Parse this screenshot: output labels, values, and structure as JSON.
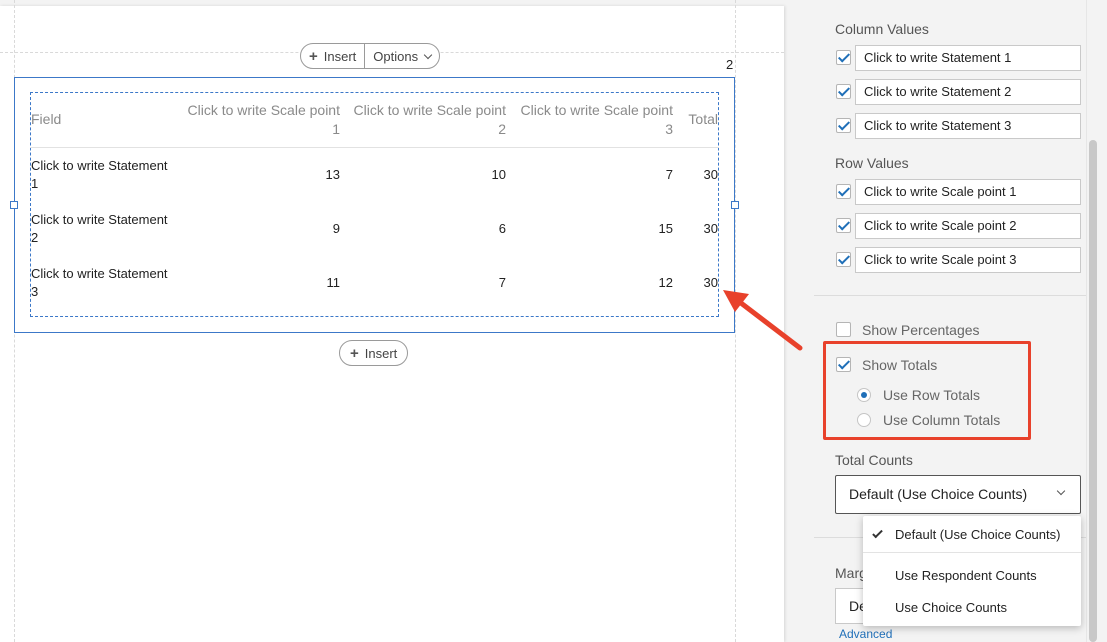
{
  "canvas": {
    "insert_label": "Insert",
    "options_label": "Options",
    "page_number": "2",
    "table": {
      "headers": [
        "Field",
        "Click to write Scale point 1",
        "Click to write Scale point 2",
        "Click to write Scale point 3",
        "Total"
      ],
      "header_lines": [
        [
          "Field"
        ],
        [
          "Click to write Scale point",
          "1"
        ],
        [
          "Click to write Scale point",
          "2"
        ],
        [
          "Click to write Scale point",
          "3"
        ],
        [
          "Total"
        ]
      ],
      "rows": [
        {
          "field_lines": [
            "Click to write Statement",
            "1"
          ],
          "values": [
            "13",
            "10",
            "7",
            "30"
          ]
        },
        {
          "field_lines": [
            "Click to write Statement",
            "2"
          ],
          "values": [
            "9",
            "6",
            "15",
            "30"
          ]
        },
        {
          "field_lines": [
            "Click to write Statement",
            "3"
          ],
          "values": [
            "11",
            "7",
            "12",
            "30"
          ]
        }
      ]
    }
  },
  "panel": {
    "column_values_label": "Column Values",
    "column_values": [
      {
        "label": "Click to write Statement 1",
        "checked": true
      },
      {
        "label": "Click to write Statement 2",
        "checked": true
      },
      {
        "label": "Click to write Statement 3",
        "checked": true
      }
    ],
    "row_values_label": "Row Values",
    "row_values": [
      {
        "label": "Click to write Scale point 1",
        "checked": true
      },
      {
        "label": "Click to write Scale point 2",
        "checked": true
      },
      {
        "label": "Click to write Scale point 3",
        "checked": true
      }
    ],
    "show_percentages": {
      "label": "Show Percentages",
      "checked": false
    },
    "show_totals": {
      "label": "Show Totals",
      "checked": true
    },
    "use_row_totals": {
      "label": "Use Row Totals",
      "selected": true
    },
    "use_column_totals": {
      "label": "Use Column Totals",
      "selected": false
    },
    "total_counts_label": "Total Counts",
    "total_counts_value": "Default (Use Choice Counts)",
    "dropdown_options": [
      {
        "label": "Default (Use Choice Counts)",
        "selected": true
      },
      {
        "label": "Use Respondent Counts",
        "selected": false
      },
      {
        "label": "Use Choice Counts",
        "selected": false
      }
    ],
    "margins_label_partial": "Marg",
    "margins_input_partial": "De",
    "advanced_link": "Advanced"
  },
  "colors": {
    "accent_blue": "#1f6fb8",
    "selection_blue": "#3c78c8",
    "annotation_red": "#e8412b"
  }
}
